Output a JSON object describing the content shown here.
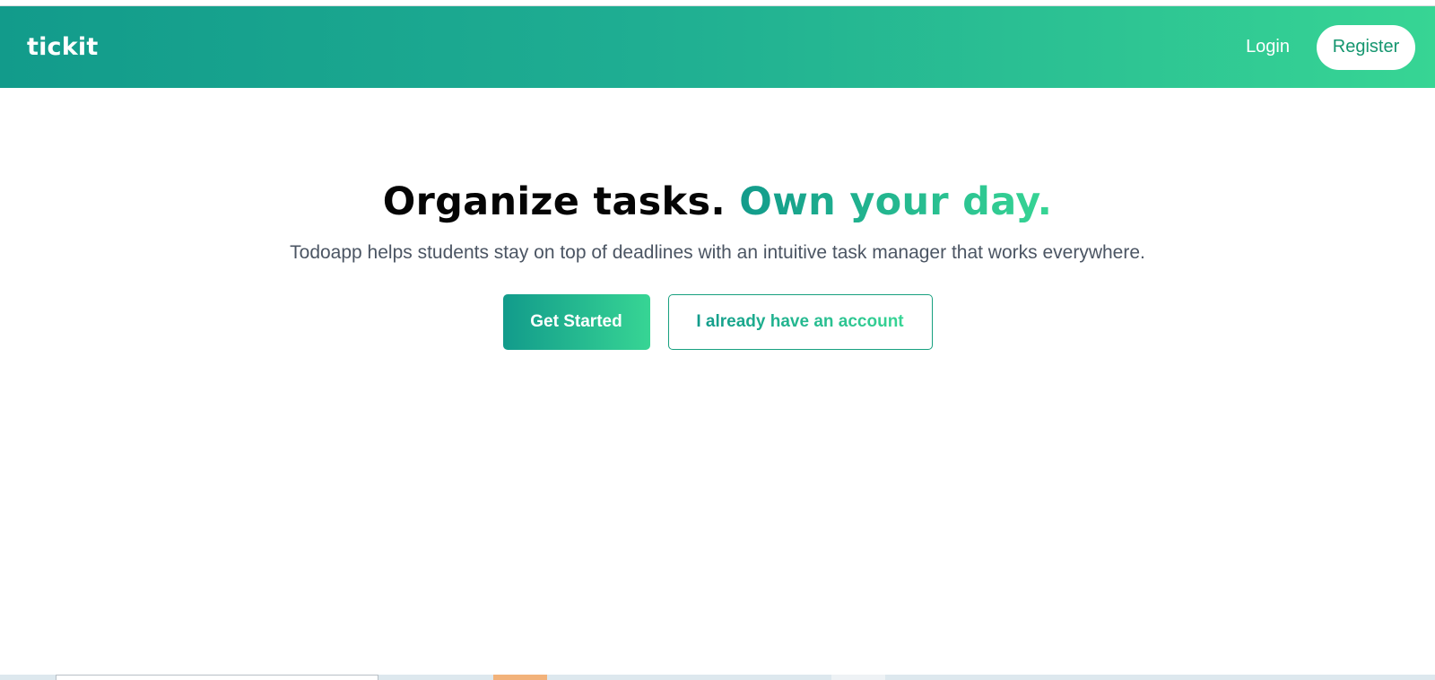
{
  "nav": {
    "brand": "tickit",
    "login_label": "Login",
    "register_label": "Register"
  },
  "hero": {
    "headline_plain": "Organize tasks.",
    "headline_accent": "Own your day.",
    "subtitle": "Todoapp helps students stay on top of deadlines with an intuitive task manager that works everywhere.",
    "primary_cta": "Get Started",
    "secondary_cta": "I already have an account"
  },
  "colors": {
    "brand_gradient_start": "#129b8b",
    "brand_gradient_end": "#37d594",
    "headline_text": "#050505",
    "subtitle_text": "#4b5563",
    "register_text": "#15966f"
  }
}
